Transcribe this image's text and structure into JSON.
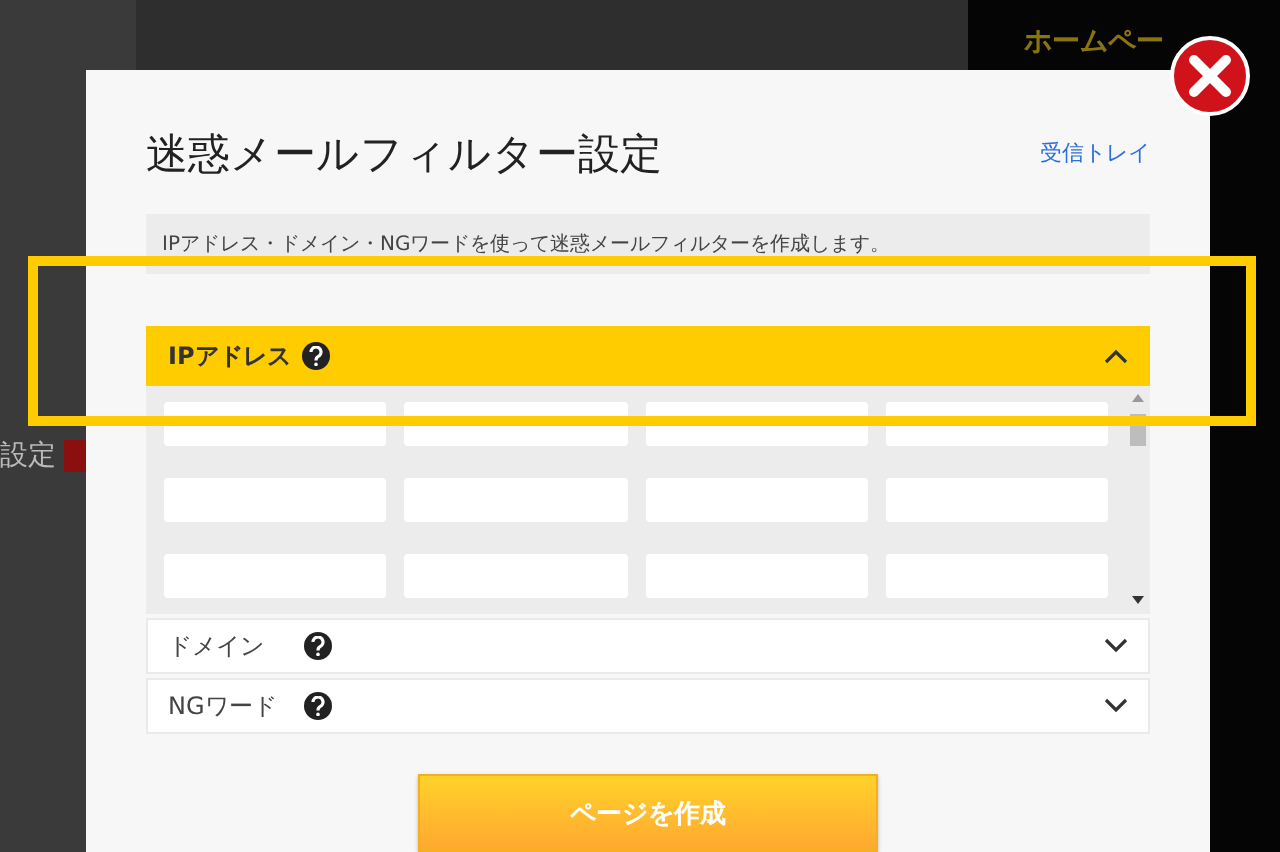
{
  "background": {
    "side_label": "設定",
    "banner_text": "ホームペー"
  },
  "dialog": {
    "title": "迷惑メールフィルター設定",
    "inbox_link": "受信トレイ",
    "description": "IPアドレス・ドメイン・NGワードを使って迷惑メールフィルターを作成します。",
    "sections": [
      {
        "label": "IPアドレス",
        "expanded": true
      },
      {
        "label": "ドメイン",
        "expanded": false
      },
      {
        "label": "NGワード",
        "expanded": false
      }
    ],
    "submit_button": "ページを作成"
  },
  "highlight": {
    "on": true
  }
}
